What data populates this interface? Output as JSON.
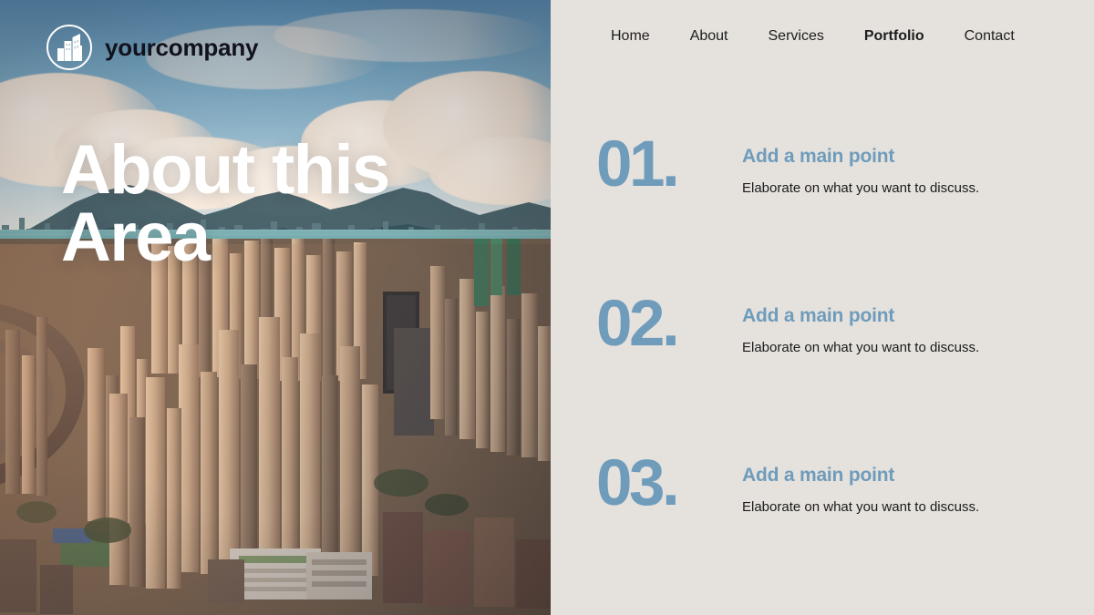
{
  "brand": {
    "name": "yourcompany",
    "logo_icon": "city-buildings-circle-logo"
  },
  "hero": {
    "title": "About this Area",
    "image_alt": "aerial-cityscape-photo"
  },
  "nav": {
    "items": [
      {
        "label": "Home",
        "active": false
      },
      {
        "label": "About",
        "active": false
      },
      {
        "label": "Services",
        "active": false
      },
      {
        "label": "Portfolio",
        "active": true
      },
      {
        "label": "Contact",
        "active": false
      }
    ]
  },
  "points": [
    {
      "number": "01.",
      "heading": "Add a main point",
      "description": "Elaborate on what you want to discuss."
    },
    {
      "number": "02.",
      "heading": "Add a main point",
      "description": "Elaborate on what you want to discuss."
    },
    {
      "number": "03.",
      "heading": "Add a main point",
      "description": "Elaborate on what you want to discuss."
    }
  ],
  "colors": {
    "panel_background": "#e5e1dd",
    "accent_blue": "#6f9cbb",
    "body_text": "#1c1c1c",
    "title_text": "#ffffff",
    "brand_text": "#12121c"
  }
}
